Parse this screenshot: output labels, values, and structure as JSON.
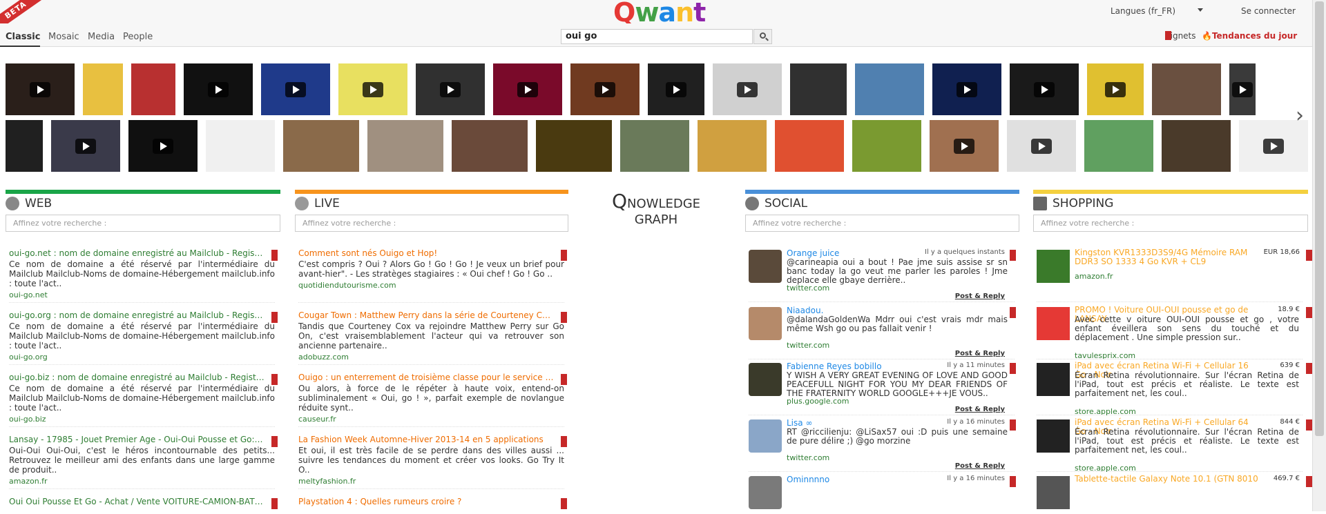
{
  "header": {
    "beta": "BETA",
    "logo": [
      "Q",
      "w",
      "a",
      "n",
      "t"
    ],
    "languages": "Langues (fr_FR)",
    "connect": "Se connecter"
  },
  "nav": {
    "tabs": [
      "Classic",
      "Mosaic",
      "Media",
      "People"
    ],
    "search_value": "oui go",
    "signets": "Signets",
    "trends": "Tendances du jour"
  },
  "columns": {
    "web": {
      "title": "WEB",
      "filter": "Affinez votre recherche :",
      "color": "#1aa548"
    },
    "live": {
      "title": "LIVE",
      "filter": "Affinez votre recherche :",
      "color": "#f7941d"
    },
    "social": {
      "title": "SOCIAL",
      "filter": "Affinez votre recherche :",
      "color": "#4a90d9"
    },
    "shopping": {
      "title": "SHOPPING",
      "filter": "Affinez votre recherche :",
      "color": "#f4d03f"
    }
  },
  "qnowledge": {
    "q": "Q",
    "rest": "NOWLEDGE",
    "graph": "GRAPH"
  },
  "web_results": [
    {
      "title": "oui-go.net : nom de domaine enregistré au Mailclub - Registrar ...",
      "desc": "Ce nom de domaine a été réservé par l'intermédiaire du Mailclub Mailclub-Noms de domaine-Hébergement mailclub.info : toute l'act..",
      "url": "oui-go.net"
    },
    {
      "title": "oui-go.org : nom de domaine enregistré au Mailclub - Registrar ...",
      "desc": "Ce nom de domaine a été réservé par l'intermédiaire du Mailclub Mailclub-Noms de domaine-Hébergement mailclub.info : toute l'act..",
      "url": "oui-go.org"
    },
    {
      "title": "oui-go.biz : nom de domaine enregistré au Mailclub - Registrar ...",
      "desc": "Ce nom de domaine a été réservé par l'intermédiaire du Mailclub Mailclub-Noms de domaine-Hébergement mailclub.info : toute l'act..",
      "url": "oui-go.biz"
    },
    {
      "title": "Lansay - 17985 - Jouet Premier Age - Oui-Oui Pousse et Go: Amazon ...",
      "desc": "Oui-Oui Oui-Oui, c'est le héros incontournable des petits... Retrouvez le meilleur ami des enfants dans une large gamme de produit..",
      "url": "amazon.fr"
    },
    {
      "title": "Oui Oui Pousse Et Go - Achat / Vente VOITURE-CAMION-BATEAU-",
      "desc": "",
      "url": ""
    }
  ],
  "live_results": [
    {
      "title": "Comment sont nés Ouigo et Hop!",
      "desc": "C'est compris ? Oui ? Alors Go ! Go ! Go ! Je veux un brief pour avant-hier\". - Les stratèges stagiaires : « Oui chef ! Go ! Go ..",
      "url": "quotidiendutourisme.com"
    },
    {
      "title": "Cougar Town : Matthew Perry dans la série de Courteney Cox ?",
      "desc": "Tandis que Courteney Cox va rejoindre Matthew Perry sur Go On, c'est vraisemblablement l'acteur qui va retrouver son ancienne partenaire..",
      "url": "adobuzz.com"
    },
    {
      "title": "Ouigo : un enterrement de troisième classe pour le service public",
      "desc": "Ou alors, à force de le répéter à haute voix, entend-on subliminalement « Oui, go ! », parfait exemple de novlangue réduite synt..",
      "url": "causeur.fr"
    },
    {
      "title": "La Fashion Week Automne-Hiver 2013-14 en 5 applications",
      "desc": "Et oui, il est très facile de se perdre dans des villes aussi ... suivre les tendances du moment et créer vos looks. Go Try It O..",
      "url": "meltyfashion.fr"
    },
    {
      "title": "Playstation 4 : Quelles rumeurs croire ?",
      "desc": "",
      "url": ""
    }
  ],
  "social_results": [
    {
      "name": "Orange juice",
      "time": "Il y a quelques instants",
      "text": "@carineapia oui a bout ! Pae jme suis assise sr sn banc today la go veut me parler les paroles ! Jme deplace elle gbaye derrière..",
      "src": "twitter.com",
      "action": "Post & Reply",
      "avatar": "#5a4a3a"
    },
    {
      "name": "Niaadou.",
      "time": "",
      "text": "@dalandaGoldenWa Mdrr oui c'est vrais mdr mais même Wsh go ou pas fallait venir !",
      "src": "twitter.com",
      "action": "Post & Reply",
      "avatar": "#b58a6a"
    },
    {
      "name": "Fabienne Reyes bobillo",
      "time": "Il y a 11 minutes",
      "text": "Y WISH A VERY GREAT EVENING OF LOVE AND GOOD PEACEFULL NIGHT FOR YOU MY DEAR FRIENDS OF THE FRATERNITY WORLD GOOGLE+++JE VOUS..",
      "src": "plus.google.com",
      "action": "Post & Reply",
      "avatar": "#3a3a2a"
    },
    {
      "name": "Lisa ∞",
      "time": "Il y a 16 minutes",
      "text": "RT @riccilienju: @LiSax57 oui :D puis une semaine de pure délire ;) @go morzine",
      "src": "twitter.com",
      "action": "Post & Reply",
      "avatar": "#8aa6c8"
    },
    {
      "name": "Ominnnno",
      "time": "Il y a 16 minutes",
      "text": "",
      "src": "",
      "action": "",
      "avatar": "#7a7a7a"
    }
  ],
  "shop_results": [
    {
      "name": "Kingston KVR1333D3S9/4G Mémoire RAM DDR3 SO 1333 4 Go KVR + CL9",
      "price": "EUR 18,66",
      "text": "",
      "src": "amazon.fr",
      "img": "#3a7a2a"
    },
    {
      "name": "PROMO ! Voiture OUI-OUI pousse et go de LANSAY",
      "price": "18.9 €",
      "text": "Avec cette v oiture OUI-OUI pousse et go , votre enfant éveillera son sens du touché et du déplacement . Une simple pression sur..",
      "src": "tavulesprix.com",
      "img": "#e53935"
    },
    {
      "name": "iPad avec écran Retina Wi-Fi + Cellular 16 Go - Noir",
      "price": "639 €",
      "text": "Écran Retina révolutionnaire. Sur l'écran Retina de l'iPad, tout est précis et réaliste. Le texte est parfaitement net, les coul..",
      "src": "store.apple.com",
      "img": "#222222"
    },
    {
      "name": "iPad avec écran Retina Wi-Fi + Cellular 64 Go - Noir",
      "price": "844 €",
      "text": "Écran Retina révolutionnaire. Sur l'écran Retina de l'iPad, tout est précis et réaliste. Le texte est parfaitement net, les coul..",
      "src": "store.apple.com",
      "img": "#222222"
    },
    {
      "name": "Tablette-tactile Galaxy Note 10.1 (GTN 8010",
      "price": "469.7 €",
      "text": "",
      "src": "",
      "img": "#555555"
    }
  ],
  "thumbnail_colors": {
    "row1": [
      "#2a1f1a",
      "#e8c040",
      "#b83030",
      "#111111",
      "#1f3a8a",
      "#e8e060",
      "#303030",
      "#7a0a2a",
      "#703a20",
      "#202020",
      "#d0d0d0",
      "#303030",
      "#5080b0",
      "#102050",
      "#1a1a1a",
      "#e0c030",
      "#6a5040",
      "#3a3a3a"
    ],
    "row2": [
      "#202020",
      "#3a3a4a",
      "#101010",
      "#f0f0f0",
      "#8a6a4a",
      "#a09080",
      "#6a4a3a",
      "#4a3a10",
      "#6a7a5a",
      "#d0a040",
      "#e05030",
      "#7a9a30",
      "#a07050",
      "#e0e0e0",
      "#60a060",
      "#4a3a2a",
      "#f0f0f0",
      "#303030"
    ]
  }
}
